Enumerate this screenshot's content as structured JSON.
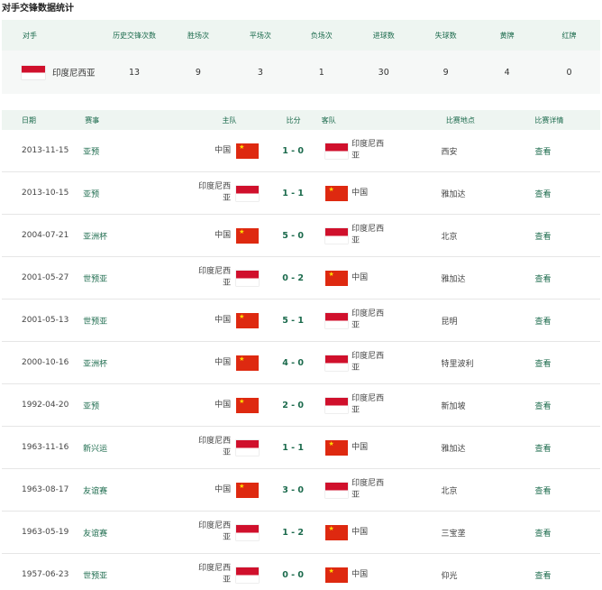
{
  "page_title": "对手交锋数据统计",
  "summary": {
    "headers": {
      "opponent": "对手",
      "history": "历史交锋次数",
      "wins": "胜场次",
      "draws": "平场次",
      "losses": "负场次",
      "goals_for": "进球数",
      "goals_against": "失球数",
      "yellow": "黄牌",
      "red": "红牌"
    },
    "row": {
      "opponent": "印度尼西亚",
      "history": "13",
      "wins": "9",
      "draws": "3",
      "losses": "1",
      "goals_for": "30",
      "goals_against": "9",
      "yellow": "4",
      "red": "0"
    }
  },
  "matches": {
    "headers": {
      "date": "日期",
      "competition": "赛事",
      "home": "主队",
      "score": "比分",
      "away": "客队",
      "venue": "比赛地点",
      "detail": "比赛详情"
    },
    "rows": [
      {
        "date": "2013-11-15",
        "competition": "亚预",
        "home": "中国",
        "home_flag": "cn",
        "score": "1 - 0",
        "away": "印度尼西亚",
        "away_flag": "id",
        "venue": "西安",
        "detail": "查看"
      },
      {
        "date": "2013-10-15",
        "competition": "亚预",
        "home": "印度尼西亚",
        "home_flag": "id",
        "score": "1 - 1",
        "away": "中国",
        "away_flag": "cn",
        "venue": "雅加达",
        "detail": "查看"
      },
      {
        "date": "2004-07-21",
        "competition": "亚洲杯",
        "home": "中国",
        "home_flag": "cn",
        "score": "5 - 0",
        "away": "印度尼西亚",
        "away_flag": "id",
        "venue": "北京",
        "detail": "查看"
      },
      {
        "date": "2001-05-27",
        "competition": "世预亚",
        "home": "印度尼西亚",
        "home_flag": "id",
        "score": "0 - 2",
        "away": "中国",
        "away_flag": "cn",
        "venue": "雅加达",
        "detail": "查看"
      },
      {
        "date": "2001-05-13",
        "competition": "世预亚",
        "home": "中国",
        "home_flag": "cn",
        "score": "5 - 1",
        "away": "印度尼西亚",
        "away_flag": "id",
        "venue": "昆明",
        "detail": "查看"
      },
      {
        "date": "2000-10-16",
        "competition": "亚洲杯",
        "home": "中国",
        "home_flag": "cn",
        "score": "4 - 0",
        "away": "印度尼西亚",
        "away_flag": "id",
        "venue": "特里波利",
        "detail": "查看"
      },
      {
        "date": "1992-04-20",
        "competition": "亚预",
        "home": "中国",
        "home_flag": "cn",
        "score": "2 - 0",
        "away": "印度尼西亚",
        "away_flag": "id",
        "venue": "新加坡",
        "detail": "查看"
      },
      {
        "date": "1963-11-16",
        "competition": "新兴运",
        "home": "印度尼西亚",
        "home_flag": "id",
        "score": "1 - 1",
        "away": "中国",
        "away_flag": "cn",
        "venue": "雅加达",
        "detail": "查看"
      },
      {
        "date": "1963-08-17",
        "competition": "友谊赛",
        "home": "中国",
        "home_flag": "cn",
        "score": "3 - 0",
        "away": "印度尼西亚",
        "away_flag": "id",
        "venue": "北京",
        "detail": "查看"
      },
      {
        "date": "1963-05-19",
        "competition": "友谊赛",
        "home": "印度尼西亚",
        "home_flag": "id",
        "score": "1 - 2",
        "away": "中国",
        "away_flag": "cn",
        "venue": "三宝垄",
        "detail": "查看"
      },
      {
        "date": "1957-06-23",
        "competition": "世预亚",
        "home": "印度尼西亚",
        "home_flag": "id",
        "score": "0 - 0",
        "away": "中国",
        "away_flag": "cn",
        "venue": "仰光",
        "detail": "查看"
      }
    ]
  },
  "colors": {
    "accent": "#1c6b4d",
    "header_bg": "#eef5f1",
    "row_bg": "#f6f8f7",
    "china_red": "#de2910",
    "indonesia_red": "#d0102c"
  }
}
